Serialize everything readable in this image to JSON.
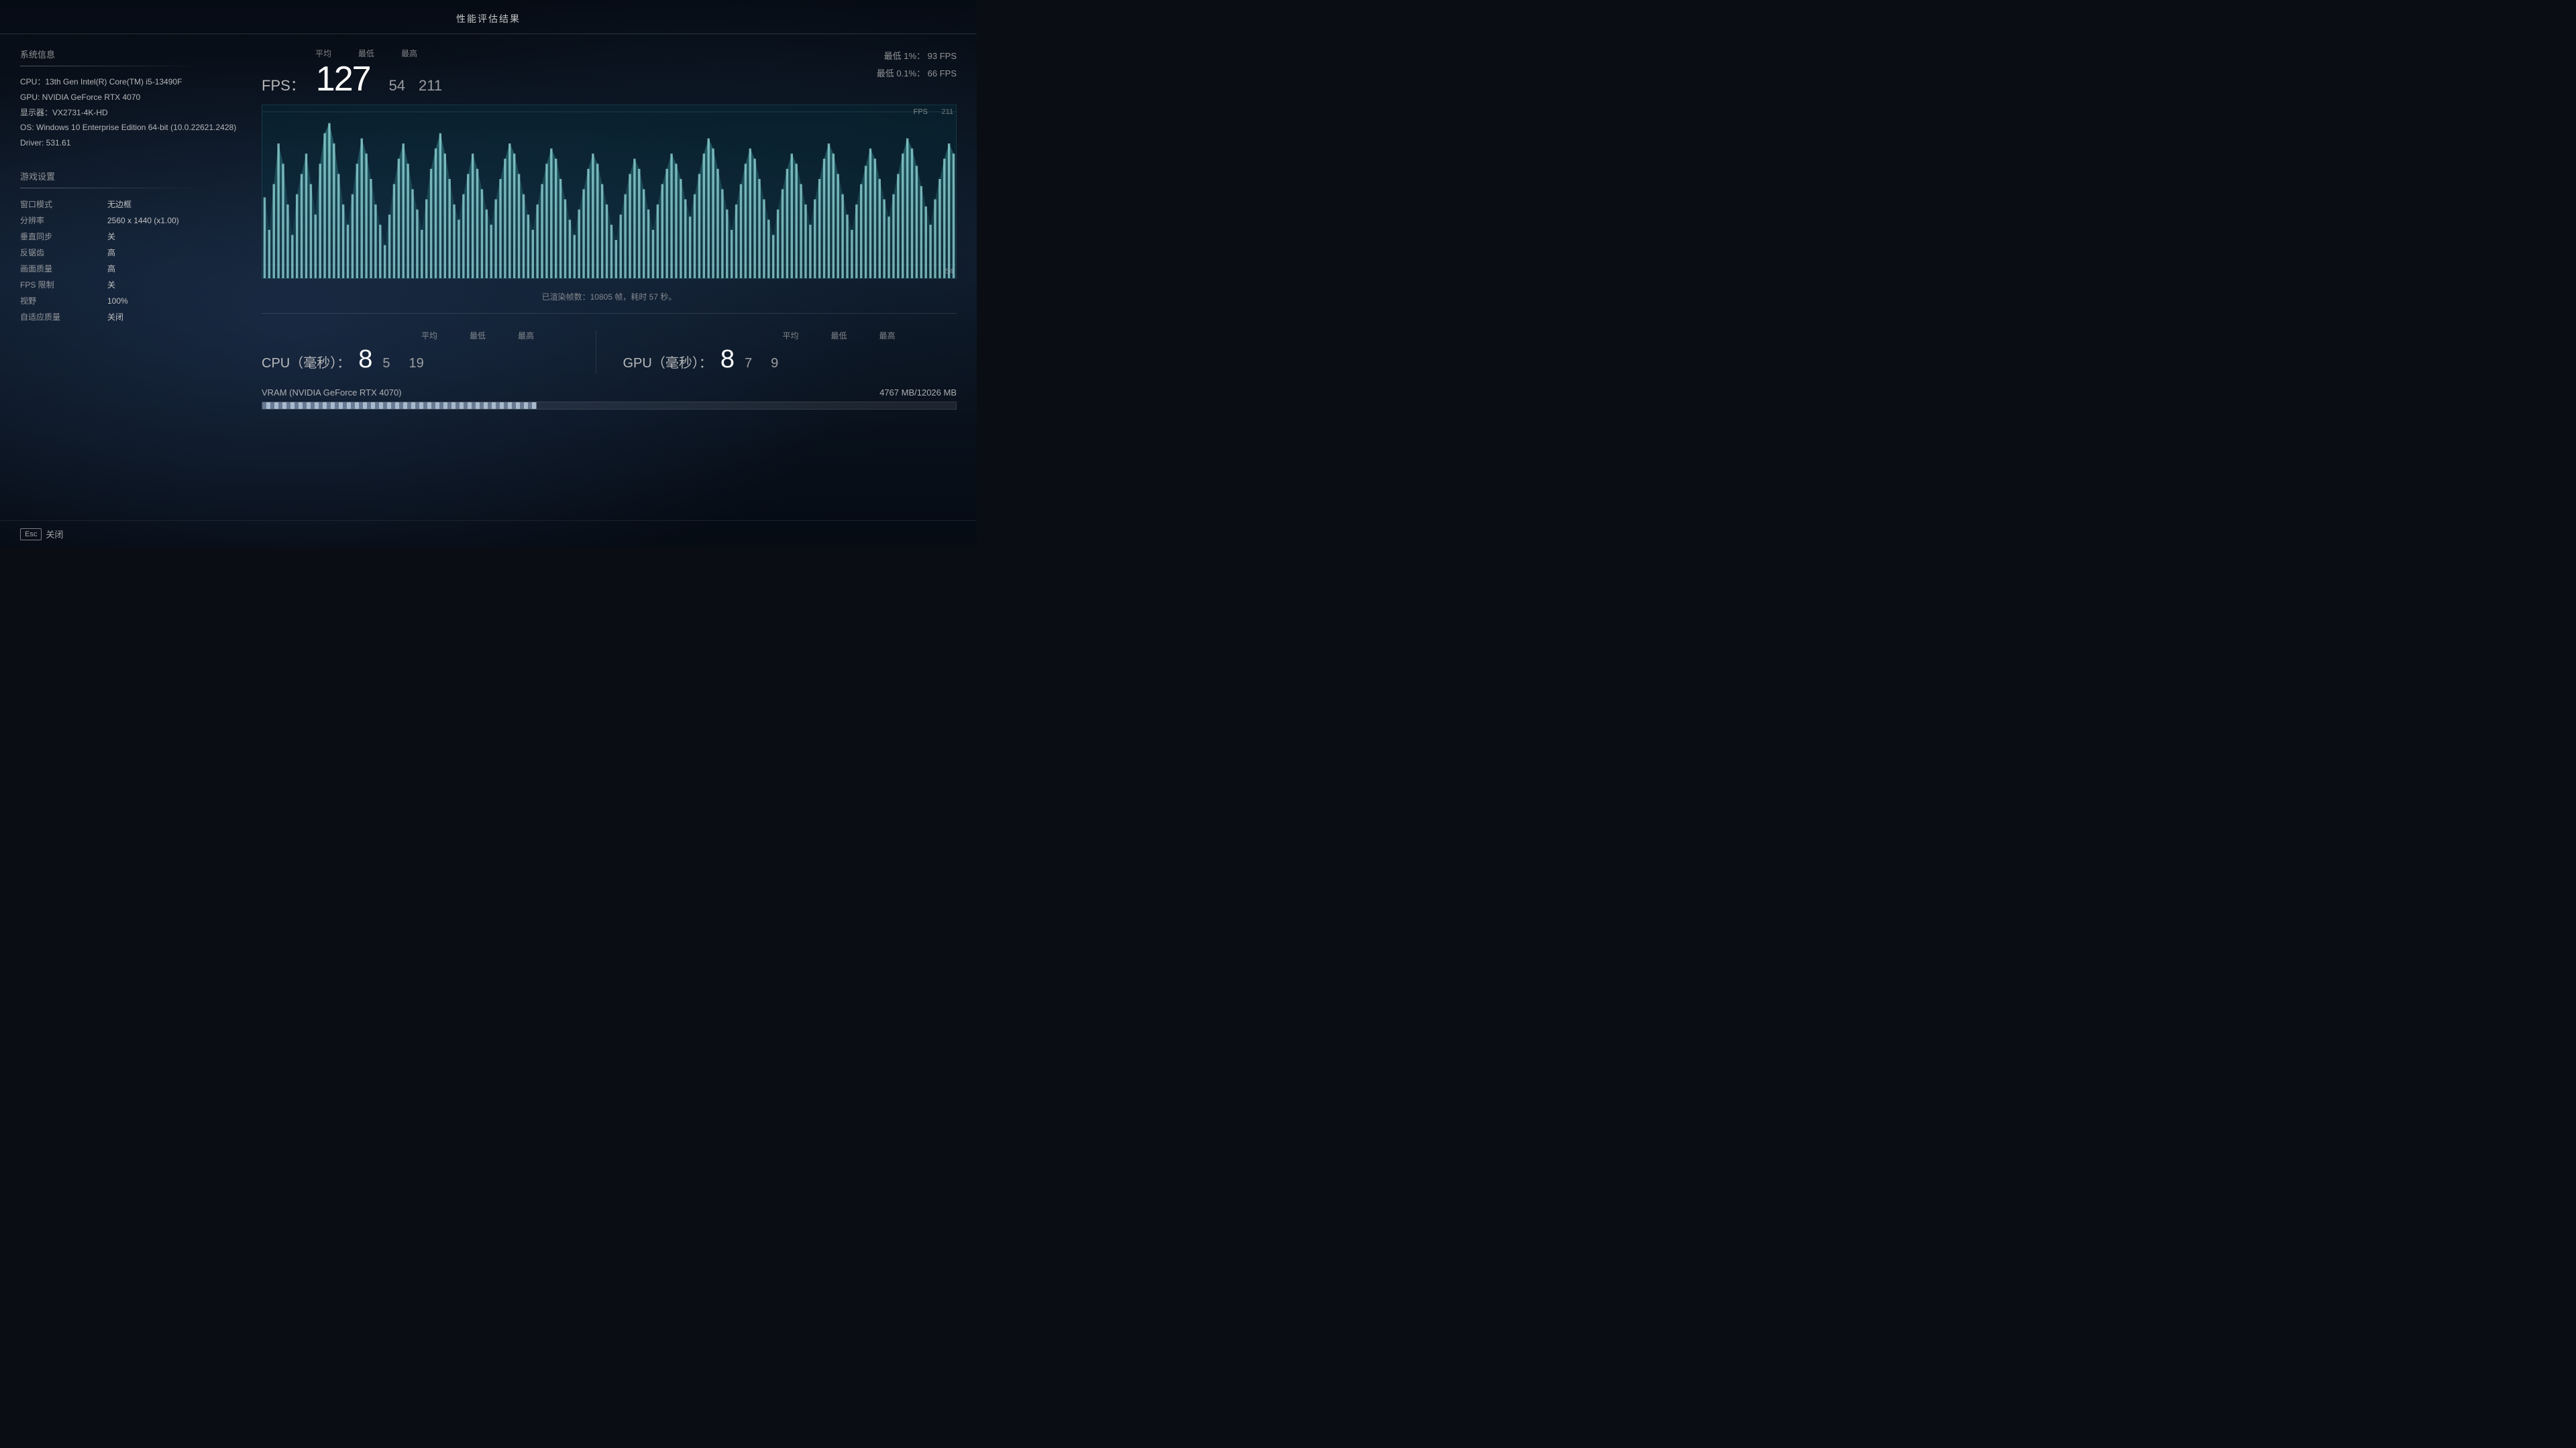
{
  "title": "性能评估结果",
  "system_info": {
    "section_title": "系统信息",
    "cpu": "CPU：13th Gen Intel(R) Core(TM) i5-13490F",
    "gpu": "GPU: NVIDIA GeForce RTX 4070",
    "display": "显示器：VX2731-4K-HD",
    "os": "OS: Windows 10 Enterprise Edition 64-bit (10.0.22621.2428)",
    "driver": "Driver: 531.61"
  },
  "game_settings": {
    "section_title": "游戏设置",
    "rows": [
      {
        "key": "窗口模式",
        "value": "无边框"
      },
      {
        "key": "分辨率",
        "value": "2560 x 1440 (x1.00)"
      },
      {
        "key": "垂直同步",
        "value": "关"
      },
      {
        "key": "反锯齿",
        "value": "高"
      },
      {
        "key": "画面质量",
        "value": "高"
      },
      {
        "key": "FPS 限制",
        "value": "关"
      },
      {
        "key": "视野",
        "value": "100%"
      },
      {
        "key": "自适应质量",
        "value": "关闭"
      }
    ]
  },
  "fps": {
    "prefix": "FPS：",
    "avg_label": "平均",
    "min_label": "最低",
    "max_label": "最高",
    "avg": "127",
    "min": "54",
    "max": "211",
    "low1pct_label": "最低 1%：",
    "low1pct_value": "93 FPS",
    "low01pct_label": "最低 0.1%：",
    "low01pct_value": "66 FPS",
    "chart_fps_label": "FPS",
    "chart_max_label": "211",
    "chart_min_label": "54",
    "rendered_info": "已渲染帧数：10805 帧，耗时 57 秒。"
  },
  "cpu_timing": {
    "prefix": "CPU（毫秒）：",
    "avg_label": "平均",
    "min_label": "最低",
    "max_label": "最高",
    "avg": "8",
    "min": "5",
    "max": "19"
  },
  "gpu_timing": {
    "prefix": "GPU（毫秒）：",
    "avg_label": "平均",
    "min_label": "最低",
    "max_label": "最高",
    "avg": "8",
    "min": "7",
    "max": "9"
  },
  "vram": {
    "title": "VRAM (NVIDIA GeForce RTX 4070)",
    "used": "4767 MB",
    "total": "12026 MB",
    "display": "4767 MB/12026 MB",
    "fill_percent": 39.6
  },
  "bottom": {
    "esc_label": "Esc",
    "close_label": "关闭"
  }
}
